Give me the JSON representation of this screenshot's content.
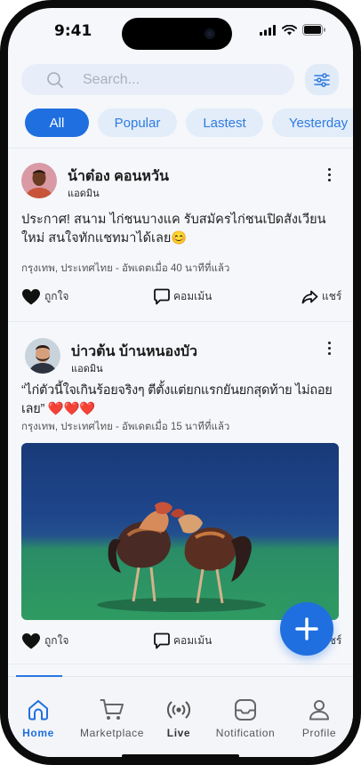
{
  "status_bar": {
    "time": "9:41"
  },
  "search": {
    "placeholder": "Search..."
  },
  "filters": [
    {
      "label": "All",
      "active": true
    },
    {
      "label": "Popular",
      "active": false
    },
    {
      "label": "Lastest",
      "active": false
    },
    {
      "label": "Yesterday",
      "active": false
    }
  ],
  "posts": [
    {
      "author": "น้าต๋อง คอนหวัน",
      "role": "แอดมิน",
      "text": "ประกาศ! สนาม ไก่ชนบางแค รับสมัครไก่ชนเปิดสังเวียนใหม่ สนใจทักแชทมาได้เลย😊",
      "meta": "กรุงเทพ, ประเทศไทย - อัพเดตเมื่อ 40 นาทีที่แล้ว",
      "like_label": "ถูกใจ",
      "comment_label": "คอมเม้น",
      "share_label": "แชร์"
    },
    {
      "author": "บ่าวต้น บ้านหนองบัว",
      "role": "แอดมิน",
      "text": "“ไก่ตัวนี้ใจเกินร้อยจริงๆ ตีตั้งแต่ยกแรกยันยกสุดท้าย ไม่ถอยเลย” ❤️❤️❤️",
      "meta": "กรุงเทพ, ประเทศไทย - อัพเดตเมื่อ 15 นาทีที่แล้ว",
      "like_label": "ถูกใจ",
      "comment_label": "คอมเม้น",
      "share_label": "แชร์"
    }
  ],
  "nav": [
    {
      "label": "Home",
      "icon": "home-icon",
      "active": true
    },
    {
      "label": "Marketplace",
      "icon": "cart-icon",
      "active": false
    },
    {
      "label": "Live",
      "icon": "live-broadcast-icon",
      "active": false
    },
    {
      "label": "Notification",
      "icon": "inbox-icon",
      "active": false
    },
    {
      "label": "Profile",
      "icon": "user-icon",
      "active": false
    }
  ],
  "colors": {
    "accent": "#1f6fe0",
    "chip_bg": "#e2edf9",
    "search_bg": "#e7eef9"
  }
}
